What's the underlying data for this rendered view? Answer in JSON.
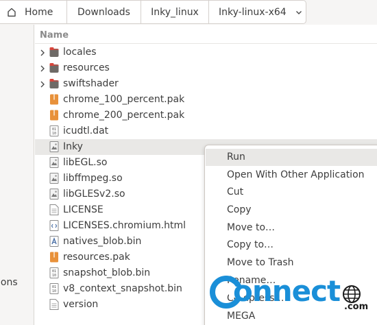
{
  "pathbar": {
    "crumbs": [
      {
        "label": "Home",
        "icon": "home-icon"
      },
      {
        "label": "Downloads"
      },
      {
        "label": "Inky_linux"
      },
      {
        "label": "Inky-linux-x64",
        "icon": "chevron-down-icon"
      }
    ]
  },
  "sidebar": {
    "partial_label": "ions"
  },
  "list": {
    "header": "Name",
    "rows": [
      {
        "name": "locales",
        "type": "folder",
        "expandable": true
      },
      {
        "name": "resources",
        "type": "folder",
        "expandable": true
      },
      {
        "name": "swiftshader",
        "type": "folder",
        "expandable": true
      },
      {
        "name": "chrome_100_percent.pak",
        "type": "archive"
      },
      {
        "name": "chrome_200_percent.pak",
        "type": "archive"
      },
      {
        "name": "icudtl.dat",
        "type": "binary"
      },
      {
        "name": "Inky",
        "type": "executable",
        "selected": true
      },
      {
        "name": "libEGL.so",
        "type": "library"
      },
      {
        "name": "libffmpeg.so",
        "type": "library"
      },
      {
        "name": "libGLESv2.so",
        "type": "library"
      },
      {
        "name": "LICENSE",
        "type": "text"
      },
      {
        "name": "LICENSES.chromium.html",
        "type": "html"
      },
      {
        "name": "natives_blob.bin",
        "type": "bin"
      },
      {
        "name": "resources.pak",
        "type": "archive"
      },
      {
        "name": "snapshot_blob.bin",
        "type": "binary"
      },
      {
        "name": "v8_context_snapshot.bin",
        "type": "binary"
      },
      {
        "name": "version",
        "type": "text"
      }
    ]
  },
  "context_menu": {
    "items": [
      {
        "label": "Run",
        "hover": true
      },
      {
        "label": "Open With Other Application"
      },
      {
        "label": "Cut"
      },
      {
        "label": "Copy"
      },
      {
        "label": "Move to…"
      },
      {
        "label": "Copy to…"
      },
      {
        "label": "Move to Trash"
      },
      {
        "label": "Rename…"
      },
      {
        "label": "Compress…"
      },
      {
        "label": "MEGA"
      }
    ]
  },
  "watermark": {
    "text": "onnect",
    "suffix": ".com"
  },
  "colors": {
    "folder": "#6e6a66",
    "folder_tab": "#d8453b",
    "archive": "#e8913a",
    "watermark": "#1a8fd8",
    "selection": "#e9e8e6"
  }
}
